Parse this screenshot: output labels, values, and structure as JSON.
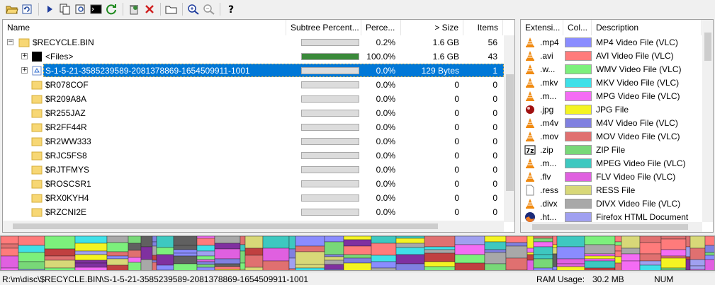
{
  "toolbar": {
    "buttons": [
      "open-icon",
      "refresh-icon",
      "play-icon",
      "copy-icon",
      "find-icon",
      "command-prompt-icon",
      "refresh-all-icon",
      "clean-icon",
      "delete-icon",
      "new-folder-icon",
      "zoom-in-icon",
      "zoom-out-icon",
      "help-icon"
    ]
  },
  "tree": {
    "headers": {
      "name": "Name",
      "subtree": "Subtree Percent...",
      "percent": "Perce...",
      "size": "> Size",
      "items": "Items"
    },
    "rows": [
      {
        "name": "$RECYCLE.BIN",
        "bar": 0.002,
        "percent": "0.2%",
        "size": "1.6 GB",
        "items": "56",
        "icon": "folder-icon",
        "expander": "minus"
      },
      {
        "name": "<Files>",
        "bar": 1.0,
        "percent": "100.0%",
        "size": "1.6 GB",
        "items": "43",
        "icon": "files-icon",
        "expander": "plus"
      },
      {
        "name": "S-1-5-21-3585239589-2081378869-1654509911-1001",
        "bar": 0.0,
        "percent": "0.0%",
        "size": "129 Bytes",
        "items": "1",
        "icon": "recycle-bin-icon",
        "expander": "plus",
        "selected": true
      },
      {
        "name": "$R078COF",
        "bar": 0.0,
        "percent": "0.0%",
        "size": "0",
        "items": "0",
        "icon": "folder-icon"
      },
      {
        "name": "$R209A8A",
        "bar": 0.0,
        "percent": "0.0%",
        "size": "0",
        "items": "0",
        "icon": "folder-icon"
      },
      {
        "name": "$R255JAZ",
        "bar": 0.0,
        "percent": "0.0%",
        "size": "0",
        "items": "0",
        "icon": "folder-icon"
      },
      {
        "name": "$R2FF44R",
        "bar": 0.0,
        "percent": "0.0%",
        "size": "0",
        "items": "0",
        "icon": "folder-icon"
      },
      {
        "name": "$R2WW333",
        "bar": 0.0,
        "percent": "0.0%",
        "size": "0",
        "items": "0",
        "icon": "folder-icon"
      },
      {
        "name": "$RJC5FS8",
        "bar": 0.0,
        "percent": "0.0%",
        "size": "0",
        "items": "0",
        "icon": "folder-icon"
      },
      {
        "name": "$RJTFMYS",
        "bar": 0.0,
        "percent": "0.0%",
        "size": "0",
        "items": "0",
        "icon": "folder-icon"
      },
      {
        "name": "$ROSCSR1",
        "bar": 0.0,
        "percent": "0.0%",
        "size": "0",
        "items": "0",
        "icon": "folder-icon"
      },
      {
        "name": "$RX0KYH4",
        "bar": 0.0,
        "percent": "0.0%",
        "size": "0",
        "items": "0",
        "icon": "folder-icon"
      },
      {
        "name": "$RZCNI2E",
        "bar": 0.0,
        "percent": "0.0%",
        "size": "0",
        "items": "0",
        "icon": "folder-icon"
      }
    ]
  },
  "extensions": {
    "headers": {
      "ext": "Extensi...",
      "color": "Col...",
      "desc": "Description"
    },
    "rows": [
      {
        "ext": ".mp4",
        "color": "#8a8cff",
        "desc": "MP4 Video File (VLC)",
        "icon": "vlc-icon"
      },
      {
        "ext": ".avi",
        "color": "#ff7b7b",
        "desc": "AVI Video File (VLC)",
        "icon": "vlc-icon"
      },
      {
        "ext": ".w...",
        "color": "#7cf07c",
        "desc": "WMV Video File (VLC)",
        "icon": "vlc-icon"
      },
      {
        "ext": ".mkv",
        "color": "#3fe0e8",
        "desc": "MKV Video File (VLC)",
        "icon": "vlc-icon"
      },
      {
        "ext": ".m...",
        "color": "#f46cf4",
        "desc": "MPG Video File (VLC)",
        "icon": "vlc-icon"
      },
      {
        "ext": ".jpg",
        "color": "#f4f422",
        "desc": "JPG File",
        "icon": "image-icon"
      },
      {
        "ext": ".m4v",
        "color": "#8080e0",
        "desc": "M4V Video File (VLC)",
        "icon": "vlc-icon"
      },
      {
        "ext": ".mov",
        "color": "#e07070",
        "desc": "MOV Video File (VLC)",
        "icon": "vlc-icon"
      },
      {
        "ext": ".zip",
        "color": "#78d878",
        "desc": "ZIP File",
        "icon": "zip-icon"
      },
      {
        "ext": ".m...",
        "color": "#3ec8c0",
        "desc": "MPEG Video File (VLC)",
        "icon": "vlc-icon"
      },
      {
        "ext": ".flv",
        "color": "#e060e0",
        "desc": "FLV Video File (VLC)",
        "icon": "vlc-icon"
      },
      {
        "ext": ".ress",
        "color": "#d8d878",
        "desc": "RESS File",
        "icon": "blank-file-icon"
      },
      {
        "ext": ".divx",
        "color": "#a8a8a8",
        "desc": "DIVX Video File (VLC)",
        "icon": "vlc-icon"
      },
      {
        "ext": ".ht...",
        "color": "#a0a0f0",
        "desc": "Firefox HTML Document",
        "icon": "firefox-icon"
      }
    ]
  },
  "status": {
    "path": "R:\\m\\disc\\$RECYCLE.BIN\\S-1-5-21-3585239589-2081378869-1654509911-1001",
    "ram_label": "RAM Usage:",
    "ram_value": "30.2 MB",
    "num": "NUM"
  }
}
